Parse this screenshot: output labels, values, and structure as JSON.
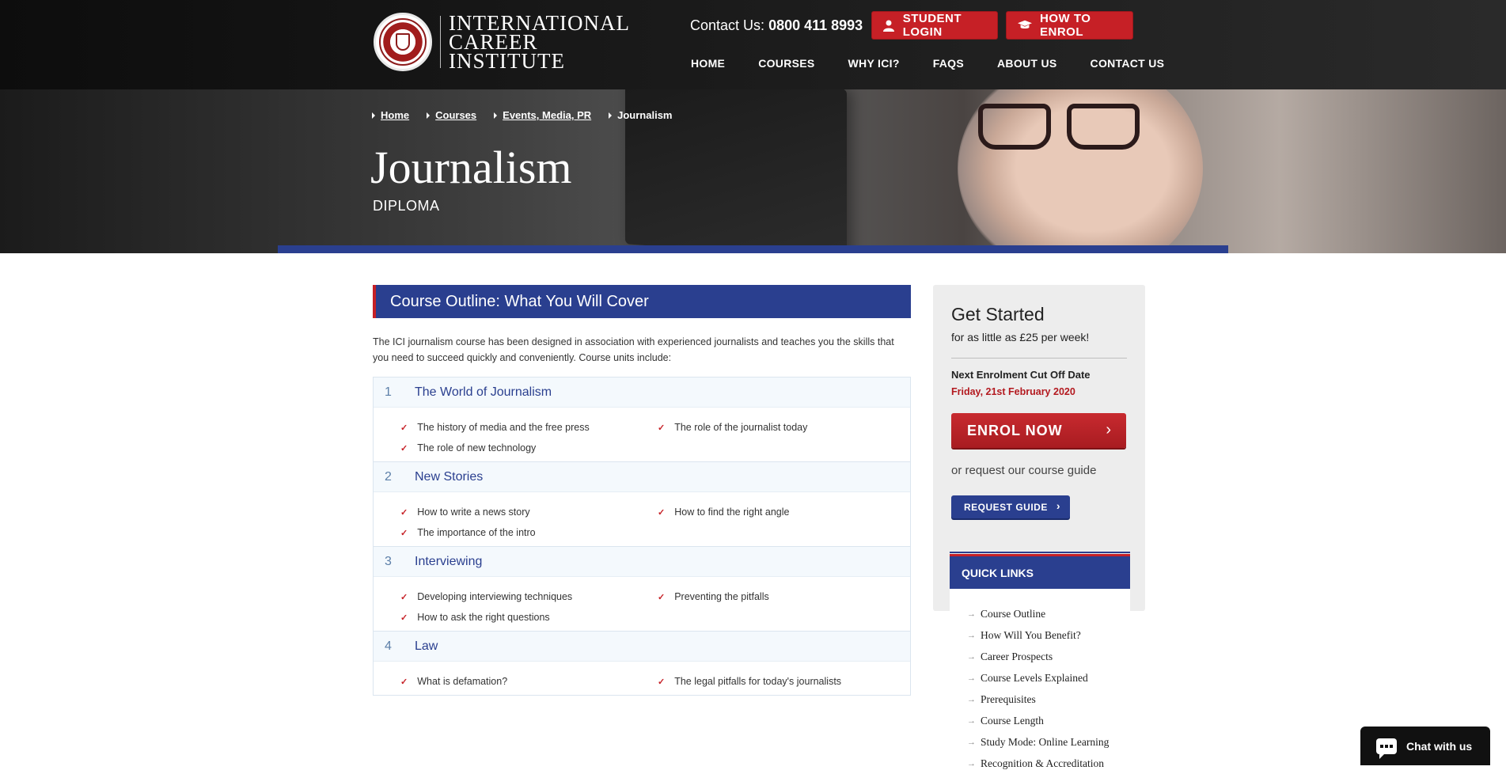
{
  "header": {
    "logo_lines": [
      "INTERNATIONAL",
      "CAREER",
      "INSTITUTE"
    ],
    "contact_label": "Contact Us:",
    "contact_phone": "0800 411 8993",
    "student_login": "STUDENT LOGIN",
    "how_to_enrol": "HOW TO ENROL",
    "nav": [
      "HOME",
      "COURSES",
      "WHY ICI?",
      "FAQS",
      "ABOUT US",
      "CONTACT US"
    ]
  },
  "hero": {
    "breadcrumb": [
      "Home",
      "Courses",
      "Events, Media, PR",
      "Journalism"
    ],
    "title": "Journalism",
    "subtitle": "DIPLOMA"
  },
  "main": {
    "section_title": "Course Outline: What You Will Cover",
    "intro": "The ICI journalism course has been designed in association with experienced journalists and teaches you the skills that you need to succeed quickly and conveniently. Course units include:",
    "units": [
      {
        "num": "1",
        "title": "The World of Journalism",
        "items": [
          "The history of media and the free press",
          "The role of the journalist today",
          "The role of new technology"
        ]
      },
      {
        "num": "2",
        "title": "New Stories",
        "items": [
          "How to write a news story",
          "How to find the right angle",
          "The importance of the intro"
        ]
      },
      {
        "num": "3",
        "title": "Interviewing",
        "items": [
          "Developing interviewing techniques",
          "Preventing the pitfalls",
          "How to ask the right questions"
        ]
      },
      {
        "num": "4",
        "title": "Law",
        "items": [
          "What is defamation?",
          "The legal pitfalls for today's journalists"
        ]
      }
    ]
  },
  "sidebar": {
    "title": "Get Started",
    "subtitle": "for as little as £25 per week!",
    "cutoff_label": "Next Enrolment Cut Off Date",
    "cutoff_date": "Friday, 21st February 2020",
    "enrol_now": "ENROL NOW",
    "or_text": "or request our course guide",
    "request_guide": "REQUEST GUIDE",
    "quick_links_title": "QUICK LINKS",
    "quick_links": [
      "Course Outline",
      "How Will You Benefit?",
      "Career Prospects",
      "Course Levels Explained",
      "Prerequisites",
      "Course Length",
      "Study Mode: Online Learning",
      "Recognition & Accreditation"
    ]
  },
  "chat": {
    "label": "Chat with us"
  },
  "colors": {
    "brand_blue": "#2a3f8f",
    "brand_red": "#c62026"
  }
}
